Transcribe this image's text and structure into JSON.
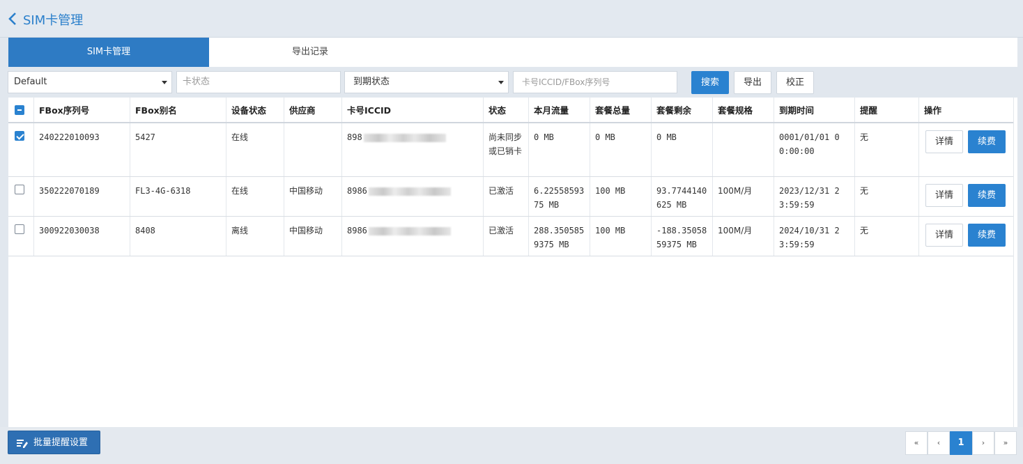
{
  "header": {
    "title": "SIM卡管理"
  },
  "tabs": [
    {
      "label": "SIM卡管理",
      "active": true
    },
    {
      "label": "导出记录",
      "active": false
    }
  ],
  "filters": {
    "group": {
      "value": "Default"
    },
    "card_status": {
      "placeholder": "卡状态"
    },
    "expiry_status": {
      "value": "到期状态"
    },
    "search": {
      "placeholder": "卡号ICCID/FBox序列号"
    },
    "search_button": "搜索",
    "export_button": "导出",
    "calibrate_button": "校正"
  },
  "table": {
    "columns": [
      "FBox序列号",
      "FBox别名",
      "设备状态",
      "供应商",
      "卡号ICCID",
      "状态",
      "本月流量",
      "套餐总量",
      "套餐剩余",
      "套餐规格",
      "到期时间",
      "提醒",
      "操作"
    ],
    "rows": [
      {
        "checked": true,
        "serial": "240222010093",
        "alias": "5427",
        "device_status": "在线",
        "supplier": "",
        "iccid": "898",
        "status": "尚未同步或已销卡",
        "month_traffic": "0 MB",
        "plan_total": "0 MB",
        "plan_remaining": "0 MB",
        "plan_spec": "",
        "expire_time": "0001/01/01 00:00:00",
        "reminder": "无",
        "detail": "详情",
        "renew": "续费"
      },
      {
        "checked": false,
        "serial": "350222070189",
        "alias": "FL3-4G-6318",
        "device_status": "在线",
        "supplier": "中国移动",
        "iccid": "8986",
        "status": "已激活",
        "month_traffic": "6.2255859375 MB",
        "plan_total": "100 MB",
        "plan_remaining": "93.7744140625 MB",
        "plan_spec": "100M/月",
        "expire_time": "2023/12/31 23:59:59",
        "reminder": "无",
        "detail": "详情",
        "renew": "续费"
      },
      {
        "checked": false,
        "serial": "300922030038",
        "alias": "8408",
        "device_status": "离线",
        "supplier": "中国移动",
        "iccid": "8986",
        "status": "已激活",
        "month_traffic": "288.3505859375 MB",
        "plan_total": "100 MB",
        "plan_remaining": "-188.3505859375 MB",
        "plan_spec": "100M/月",
        "expire_time": "2024/10/31 23:59:59",
        "reminder": "无",
        "detail": "详情",
        "renew": "续费"
      }
    ]
  },
  "footer": {
    "batch_button": "批量提醒设置",
    "pagination": {
      "first": "«",
      "prev": "‹",
      "current": "1",
      "next": "›",
      "last": "»"
    }
  },
  "colors": {
    "accent": "#2a82d0",
    "tab_active": "#2e7bc4",
    "title": "#2a7fcb"
  }
}
